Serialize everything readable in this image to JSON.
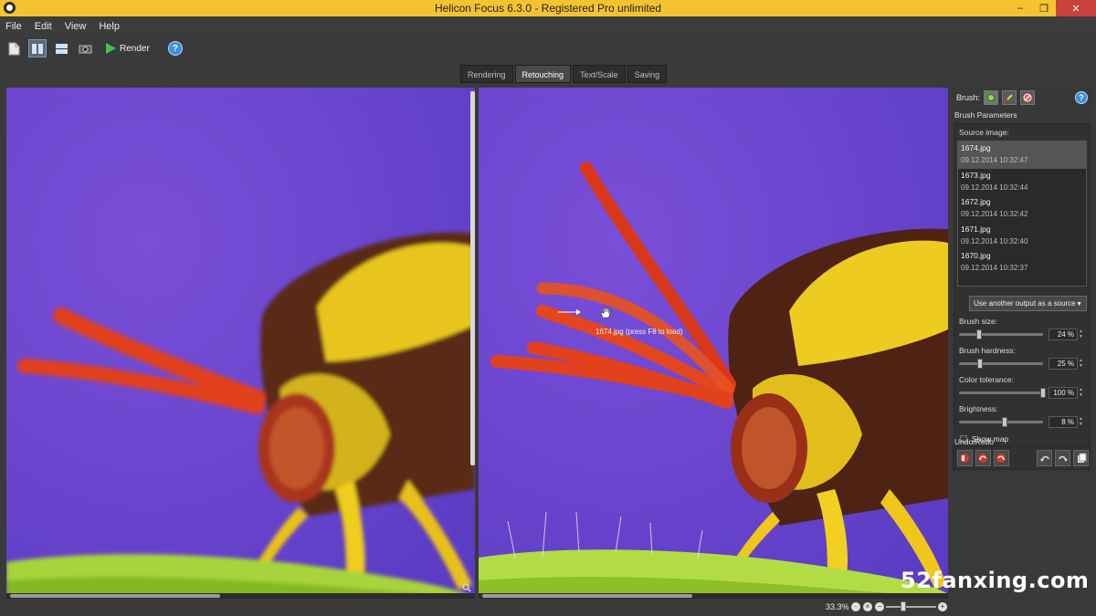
{
  "window": {
    "title": "Helicon Focus 6.3.0 - Registered Pro unlimited",
    "controls": [
      "–",
      "❐",
      "✕"
    ]
  },
  "menu": [
    "File",
    "Edit",
    "View",
    "Help"
  ],
  "toolbar": {
    "render_label": "Render",
    "help": "?"
  },
  "tabs": [
    {
      "label": "Rendering",
      "active": false
    },
    {
      "label": "Retouching",
      "active": true
    },
    {
      "label": "Text/Scale",
      "active": false
    },
    {
      "label": "Saving",
      "active": false
    }
  ],
  "viewer": {
    "overlay_label": "1674.jpg (press F8 to load)"
  },
  "panel": {
    "brush_label": "Brush:",
    "help": "?",
    "brush_params_title": "Brush Parameters",
    "source_label": "Source image:",
    "sources": [
      {
        "name": "1674.jpg",
        "date": "09.12.2014 10:32:47",
        "selected": true
      },
      {
        "name": "1673.jpg",
        "date": "09.12.2014 10:32:44",
        "selected": false
      },
      {
        "name": "1672.jpg",
        "date": "09.12.2014 10:32:42",
        "selected": false
      },
      {
        "name": "1671.jpg",
        "date": "09.12.2014 10:32:40",
        "selected": false
      },
      {
        "name": "1670.jpg",
        "date": "09.12.2014 10:32:37",
        "selected": false
      }
    ],
    "source_dropdown": "Use another output as a source",
    "params": [
      {
        "label": "Brush size:",
        "value": "24 %",
        "level": 0.24
      },
      {
        "label": "Brush hardness:",
        "value": "25 %",
        "level": 0.25
      },
      {
        "label": "Color tolerance:",
        "value": "100 %",
        "level": 1.0
      },
      {
        "label": "Brightness:",
        "value": "8 %",
        "level": 0.54
      }
    ],
    "show_map_label": "Show map",
    "undo_title": "Undo/Redo"
  },
  "status": {
    "zoom": "33.3%"
  },
  "watermark": "52fanxing.com",
  "colors": {
    "title_bar": "#f5c332",
    "background": "#7044cf",
    "accent": "#3d8fe0"
  }
}
